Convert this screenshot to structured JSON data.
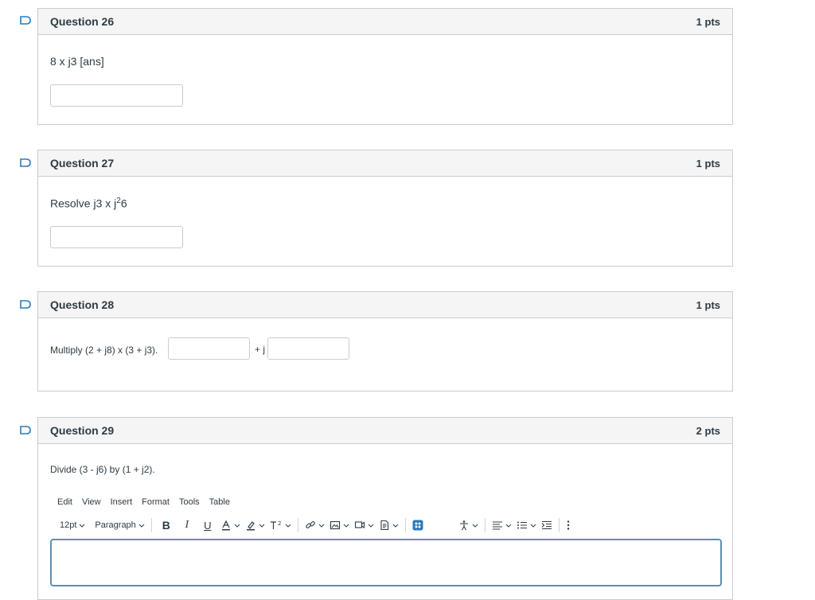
{
  "questions": [
    {
      "title": "Question 26",
      "points": "1 pts",
      "text": "8 x j3 [ans]"
    },
    {
      "title": "Question 27",
      "points": "1 pts",
      "text_before": "Resolve j3 x j",
      "text_sup": "2",
      "text_after": "6"
    },
    {
      "title": "Question 28",
      "points": "1 pts",
      "text": "Multiply (2 + j8) x (3 + j3).",
      "plus_j": "+ j"
    },
    {
      "title": "Question 29",
      "points": "2 pts",
      "text": "Divide (3 - j6) by (1 + j2)."
    }
  ],
  "editor": {
    "menu": [
      "Edit",
      "View",
      "Insert",
      "Format",
      "Tools",
      "Table"
    ],
    "font_size": "12pt",
    "block_format": "Paragraph",
    "accent_color": "#2b7abc",
    "icons": [
      "bold-icon",
      "italic-icon",
      "underline-icon",
      "text-color-icon",
      "highlight-icon",
      "superscript-icon",
      "link-icon",
      "image-icon",
      "media-icon",
      "document-icon",
      "apps-icon",
      "accessibility-icon",
      "align-icon",
      "list-icon",
      "indent-icon",
      "more-icon"
    ]
  }
}
